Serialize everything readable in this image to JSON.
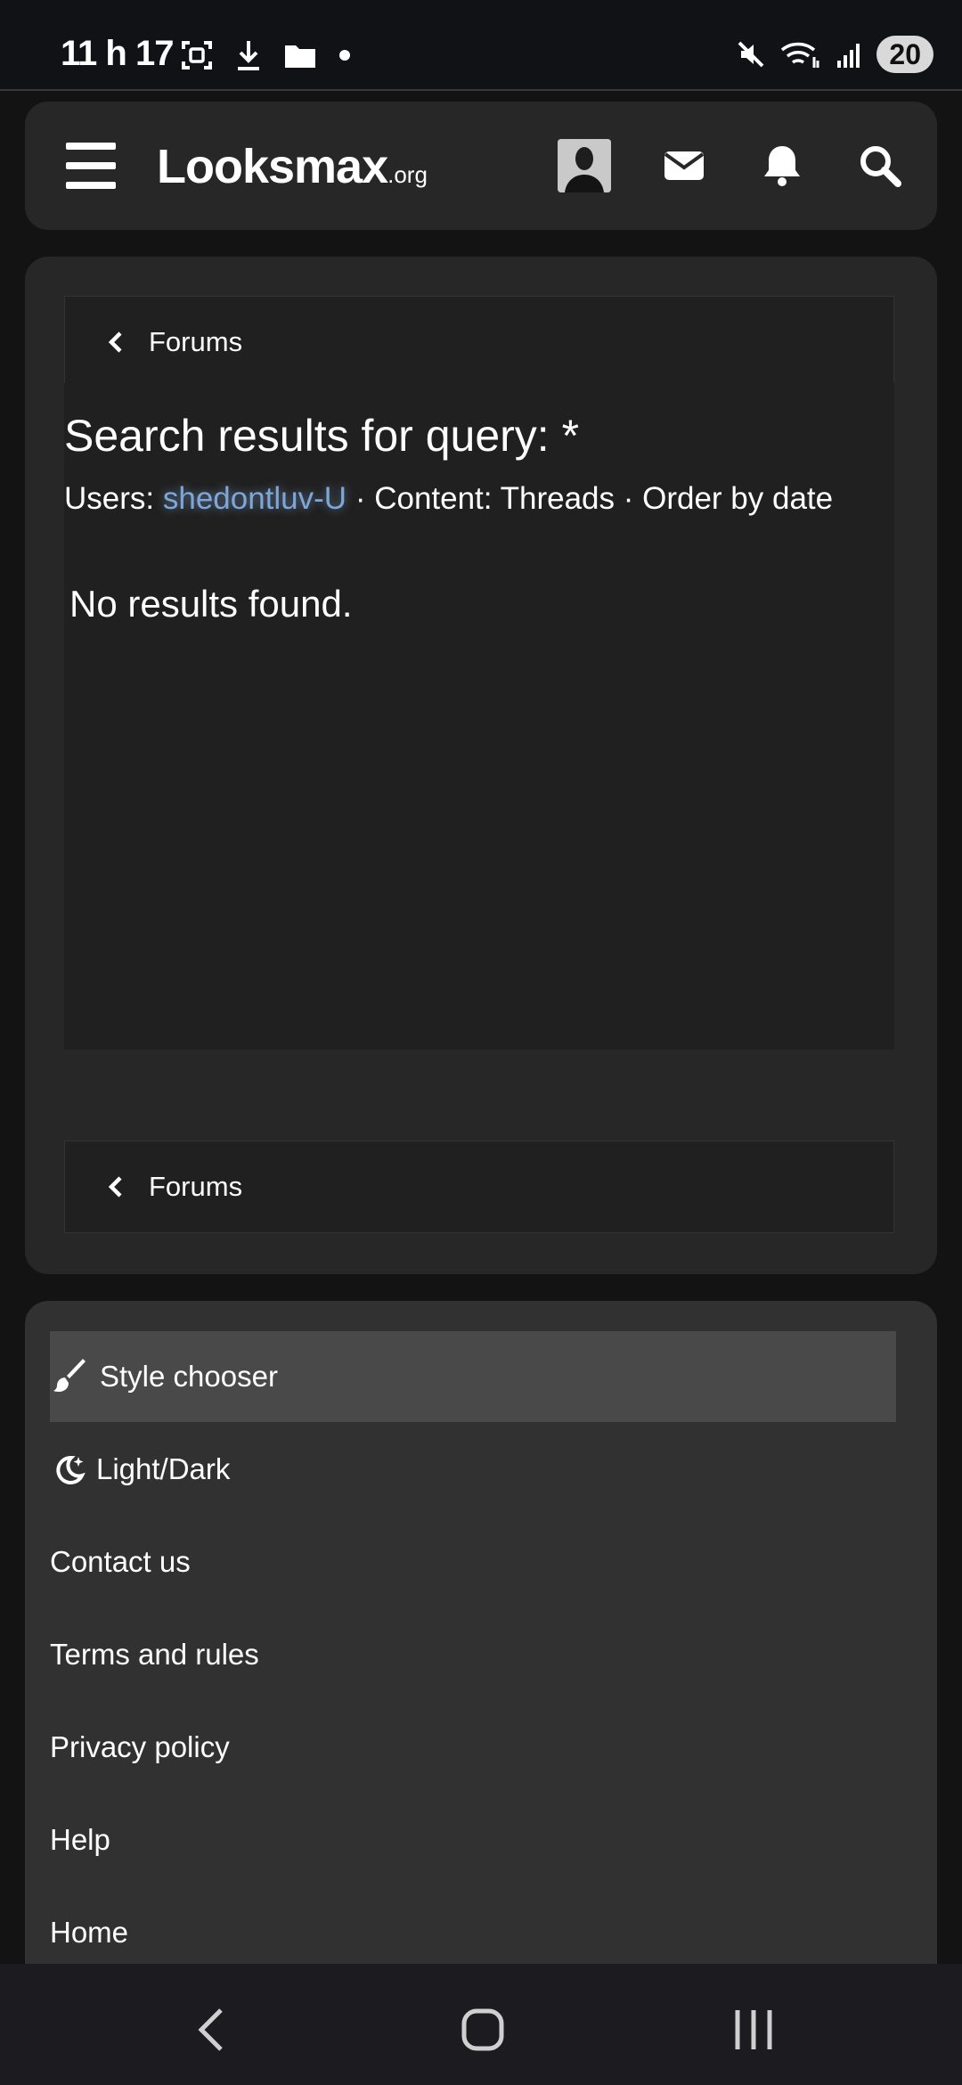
{
  "status_bar": {
    "time": "11 h 17",
    "left_icons": [
      "screenshot-icon",
      "download-icon",
      "folder-icon",
      "dot-icon"
    ],
    "right_icons": [
      "mute-icon",
      "wifi-icon",
      "signal-icon"
    ],
    "battery": "20"
  },
  "header": {
    "logo_main": "Looksmax",
    "logo_suffix": ".org",
    "icons": [
      "menu-icon",
      "avatar",
      "mail-icon",
      "bell-icon",
      "search-icon"
    ]
  },
  "breadcrumb_top": {
    "label": "Forums"
  },
  "search": {
    "title": "Search results for query: *",
    "users_prefix": "Users: ",
    "username": "shedontluv-U",
    "filters_suffix": " · Content: Threads · Order by date",
    "no_results": "No results found."
  },
  "breadcrumb_bottom": {
    "label": "Forums"
  },
  "footer": {
    "items": [
      {
        "label": "Style chooser",
        "icon": "brush-icon"
      },
      {
        "label": "Light/Dark",
        "icon": "moon-icon"
      },
      {
        "label": "Contact us"
      },
      {
        "label": "Terms and rules"
      },
      {
        "label": "Privacy policy"
      },
      {
        "label": "Help"
      },
      {
        "label": "Home"
      }
    ]
  },
  "nav_bar": {
    "buttons": [
      "back-icon",
      "home-icon",
      "recents-icon"
    ]
  },
  "colors": {
    "accent_link": "#7fa6d6",
    "page_bg": "#131313",
    "card_bg": "#272727"
  }
}
